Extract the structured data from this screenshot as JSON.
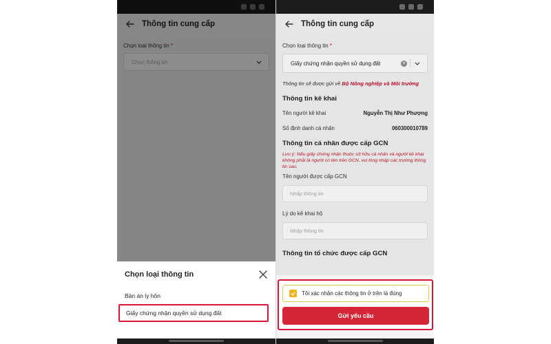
{
  "screen": {
    "title": "Thông tin cung cấp",
    "type_label": "Chọn loại thông tin",
    "required_mark": "*"
  },
  "left": {
    "select_placeholder": "Chọn thông tin",
    "sheet": {
      "title": "Chọn loại thông tin",
      "items": [
        "Bản án ly hôn",
        "Giấy chứng nhận quyền sử dụng đất"
      ]
    }
  },
  "right": {
    "selected_value": "Giấy chứng nhận quyền sử dụng đất",
    "send_note_prefix": "Thông tin sẽ được gửi về ",
    "send_note_org": "Bộ Nông nghiệp và Môi trường",
    "declarant_section": "Thông tin kê khai",
    "declarant_name_label": "Tên người kê khai",
    "declarant_name_value": "Nguyễn Thị Như Phượng",
    "personal_id_label": "Số định danh cá nhân",
    "personal_id_value": "060300010789",
    "gcn_section": "Thông tin cá nhân được cấp GCN",
    "warning": "Lưu ý: Nếu giấy chứng nhận thuộc sở hữu cá nhân và người kê khai không phải là người có tên trên GCN, vui lòng nhập các trường thông tin sau.",
    "gcn_name_label": "Tên người được cấp GCN",
    "gcn_name_placeholder": "Nhập thông tin",
    "reason_label": "Lý do kê khai hộ",
    "reason_placeholder": "Nhập thông tin",
    "org_section": "Thông tin tổ chức được cấp GCN",
    "confirm_label": "Tôi xác nhận các thông tin ở trên là đúng",
    "submit_label": "Gửi yêu cầu"
  },
  "colors": {
    "accent": "#d62536",
    "highlight_border": "#d8143a",
    "checkbox": "#f2b21a"
  }
}
